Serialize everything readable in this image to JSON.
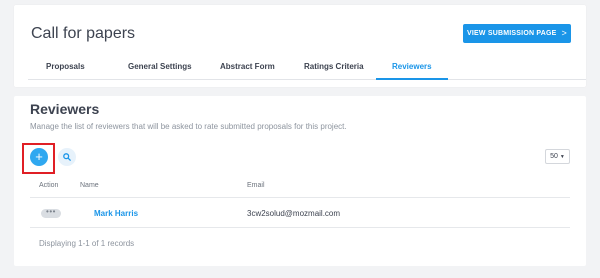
{
  "header": {
    "title": "Call for papers",
    "view_button": {
      "label": "VIEW SUBMISSION PAGE",
      "chevron": ">"
    }
  },
  "tabs": [
    {
      "label": "Proposals",
      "active": false
    },
    {
      "label": "General Settings",
      "active": false
    },
    {
      "label": "Abstract Form",
      "active": false
    },
    {
      "label": "Ratings Criteria",
      "active": false
    },
    {
      "label": "Reviewers",
      "active": true
    }
  ],
  "reviewers": {
    "title": "Reviewers",
    "description": "Manage the list of reviewers that will be asked to rate submitted proposals for this project.",
    "add_button": {
      "icon": "plus-icon",
      "glyph": "+"
    },
    "search_button": {
      "icon": "search-icon"
    },
    "page_size": "50",
    "columns": {
      "action": "Action",
      "name": "Name",
      "email": "Email"
    },
    "rows": [
      {
        "action_glyph": "•••",
        "name": "Mark Harris",
        "email": "3cw2solud@mozmail.com"
      }
    ],
    "footer": "Displaying 1-1 of 1 records"
  },
  "colors": {
    "accent": "#1a95e8",
    "highlight": "#e01f25",
    "background": "#f2f3f5"
  }
}
